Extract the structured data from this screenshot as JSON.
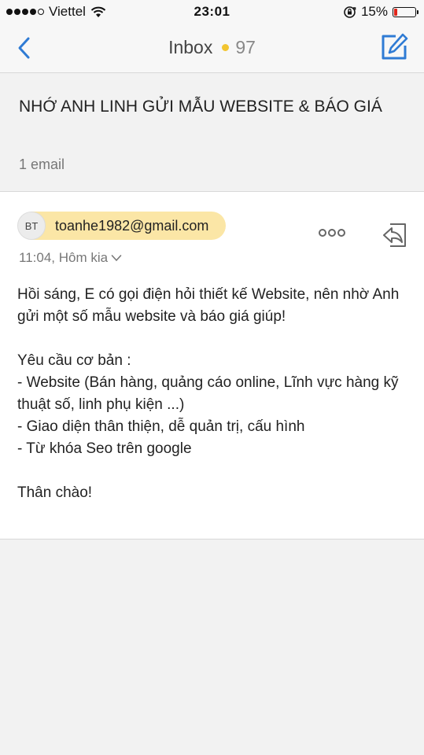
{
  "status_bar": {
    "carrier": "Viettel",
    "time": "23:01",
    "battery_percent": "15%",
    "battery_level": 0.15,
    "icons": [
      "signal-dots-icon",
      "wifi-icon",
      "rotation-lock-icon",
      "battery-icon"
    ]
  },
  "nav": {
    "title": "Inbox",
    "unread_count": "97",
    "accent_color": "#2f7bd4",
    "unread_dot_color": "#f2c530"
  },
  "thread": {
    "subject": "NHỚ ANH LINH GỬI MẪU WEBSITE & BÁO GIÁ",
    "count_label": "1 email"
  },
  "message": {
    "avatar_initials": "BT",
    "sender": "toanhe1982@gmail.com",
    "sender_chip_color": "#fbe6a6",
    "time": "11:04, Hôm kia",
    "body": {
      "line1": "Hồi sáng, E có gọi điện hỏi thiết kế Website, nên nhờ Anh gửi một số mẫu website và báo giá giúp!",
      "line2": "Yêu cầu cơ bản :",
      "line3": "- Website (Bán hàng, quảng cáo online, Lĩnh vực hàng kỹ thuật số, linh phụ kiện ...)",
      "line4": "- Giao diện thân thiện, dễ quản trị, cấu hình",
      "line5": "- Từ khóa Seo trên google",
      "line6": "Thân chào!"
    }
  }
}
